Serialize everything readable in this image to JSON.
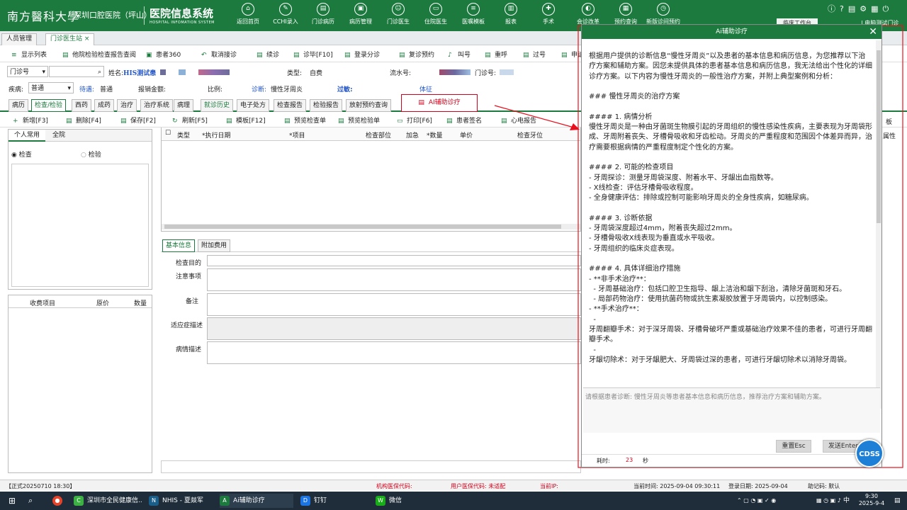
{
  "header": {
    "logo_brand": "南方醫科大學",
    "hospital": "深圳口腔医院（坪山）",
    "system_title": "医院信息系统",
    "system_subtitle": "HOSPITAL INFOMATION SYSTEM",
    "nav": [
      {
        "label": "返回首页",
        "icon": "home-icon",
        "glyph": "⌂"
      },
      {
        "label": "CCHI录入",
        "icon": "edit-icon",
        "glyph": "✎"
      },
      {
        "label": "门诊病历",
        "icon": "record-icon",
        "glyph": "▤"
      },
      {
        "label": "病历管理",
        "icon": "folder-icon",
        "glyph": "▣"
      },
      {
        "label": "门诊医生",
        "icon": "doctor-icon",
        "glyph": "☺"
      },
      {
        "label": "住院医生",
        "icon": "bed-icon",
        "glyph": "▭"
      },
      {
        "label": "医嘱模板",
        "icon": "template-icon",
        "glyph": "≡"
      },
      {
        "label": "报表",
        "icon": "chart-icon",
        "glyph": "▥"
      },
      {
        "label": "手术",
        "icon": "surgery-icon",
        "glyph": "✚"
      },
      {
        "label": "会诊改革",
        "icon": "consult-icon",
        "glyph": "◐"
      },
      {
        "label": "预约查询",
        "icon": "calendar-icon",
        "glyph": "▦"
      },
      {
        "label": "新版诊间预约",
        "icon": "clock-icon",
        "glyph": "◷"
      }
    ],
    "workspace": "临床工作台",
    "user": "| 电脑测试门诊"
  },
  "tabs": [
    "人员管理",
    "门诊医生站"
  ],
  "toolbar": [
    {
      "label": "显示列表",
      "icon": "list-icon",
      "g": "≡"
    },
    {
      "label": "他院检验检查报告查阅",
      "icon": "report-icon",
      "g": "▤"
    },
    {
      "label": "患者360",
      "icon": "patient-icon",
      "g": "▣"
    },
    {
      "label": "取消接诊",
      "icon": "cancel-icon",
      "g": "↶"
    },
    {
      "label": "续诊",
      "icon": "continue-icon",
      "g": "▤"
    },
    {
      "label": "诊毕[F10]",
      "icon": "finish-icon",
      "g": "▤"
    },
    {
      "label": "登录分诊",
      "icon": "login-icon",
      "g": "▤"
    },
    {
      "label": "复诊预约",
      "icon": "revisit-icon",
      "g": "▤"
    },
    {
      "label": "叫号",
      "icon": "bell-icon",
      "g": "♪"
    },
    {
      "label": "重呼",
      "icon": "recall-icon",
      "g": "▤"
    },
    {
      "label": "过号",
      "icon": "skip-icon",
      "g": "▤"
    },
    {
      "label": "申请",
      "icon": "apply-icon",
      "g": "▤"
    }
  ],
  "patient": {
    "clinic_label": "门诊号",
    "name_label": "姓名:",
    "name": "HIS测试患",
    "type_label": "类型:",
    "type": "自费",
    "serial_label": "流水号:",
    "clinic_no_label": "门诊号:",
    "disease_label": "疾病:",
    "disease": "普通",
    "benefit_label": "待遇:",
    "benefit": "普通",
    "amount_label": "报销金额:",
    "ratio_label": "比例:",
    "diagnosis_label": "诊断:",
    "diagnosis": "慢性牙周炎",
    "allergy_label": "过敏:",
    "sign_label": "体征"
  },
  "subtabs": [
    "病历",
    "检查/检验",
    "西药",
    "成药",
    "治疗",
    "治疗系统",
    "病理",
    "就诊历史",
    "电子处方",
    "检查报告",
    "检验报告",
    "放射预约查询"
  ],
  "ai_tab": "AI辅助诊疗",
  "toolbar2": [
    {
      "label": "新增[F3]",
      "icon": "add-icon",
      "g": "+"
    },
    {
      "label": "删除[F4]",
      "icon": "delete-icon",
      "g": "▤"
    },
    {
      "label": "保存[F2]",
      "icon": "save-icon",
      "g": "▤"
    },
    {
      "label": "刷新[F5]",
      "icon": "refresh-icon",
      "g": "↻"
    },
    {
      "label": "模板[F12]",
      "icon": "template-icon",
      "g": "▤"
    },
    {
      "label": "预览检查单",
      "icon": "preview-icon",
      "g": "▤"
    },
    {
      "label": "预览检验单",
      "icon": "preview-icon",
      "g": "▤"
    },
    {
      "label": "打印[F6]",
      "icon": "print-icon",
      "g": "▭"
    },
    {
      "label": "患者签名",
      "icon": "sign-icon",
      "g": "▤"
    },
    {
      "label": "心电报告",
      "icon": "ecg-icon",
      "g": "▤"
    }
  ],
  "left_tabs": [
    "个人常用",
    "全院"
  ],
  "left_radios": [
    "检查",
    "检验"
  ],
  "fee_cols": [
    "收费项目",
    "原价",
    "数量"
  ],
  "grid_cols": [
    "类型",
    "*执行日期",
    "*项目",
    "检查部位",
    "加急",
    "*数量",
    "单价",
    "检查牙位"
  ],
  "right_peek": [
    "板",
    "属性"
  ],
  "form_tabs": [
    "基本信息",
    "附加费用"
  ],
  "form_labels": [
    "检查目的",
    "注意事项",
    "备注",
    "适应症描述",
    "病情描述"
  ],
  "dialog": {
    "title": "Ai辅助诊疗",
    "close": "✕",
    "paragraphs": [
      "根据用户提供的诊断信息“慢性牙周炎”以及患者的基本信息和病历信息，为您推荐以下治疗方案和辅助方案。因您未提供具体的患者基本信息和病历信息，我无法给出个性化的详细诊疗方案。以下内容为慢性牙周炎的一般性治疗方案，并附上典型案例和分析：",
      "",
      "### 慢性牙周炎的治疗方案",
      "",
      "#### 1. 病情分析",
      "慢性牙周炎是一种由牙菌斑生物膜引起的牙周组织的慢性感染性疾病，主要表现为牙周袋形成、牙周附着丧失、牙槽骨吸收和牙齿松动。牙周炎的严重程度和范围因个体差异而异，治疗需要根据病情的严重程度制定个性化的方案。",
      "",
      "#### 2. 可能的检查项目",
      "- 牙周探诊：测量牙周袋深度、附着水平、牙龈出血指数等。",
      "- X线检查：评估牙槽骨吸收程度。",
      "- 全身健康评估：排除或控制可能影响牙周炎的全身性疾病，如糖尿病。",
      "",
      "#### 3. 诊断依据",
      "- 牙周袋深度超过4mm，附着丧失超过2mm。",
      "- 牙槽骨吸收X线表现为垂直或水平吸收。",
      "- 牙周组织的临床炎症表现。",
      "",
      "#### 4. 具体详细治疗措施",
      "- **非手术治疗**：",
      "  - 牙周基础治疗：包括口腔卫生指导、龈上洁治和龈下刮治，清除牙菌斑和牙石。",
      "  - 局部药物治疗：使用抗菌药物或抗生素凝胶放置于牙周袋内，以控制感染。",
      "- **手术治疗**：",
      "  -",
      "牙周翻瓣手术：对于深牙周袋、牙槽骨破坏严重或基础治疗效果不佳的患者，可进行牙周翻瓣手术。",
      "  -",
      "牙龈切除术：对于牙龈肥大、牙周袋过深的患者，可进行牙龈切除术以消除牙周袋。"
    ],
    "prompt": "请根据患者诊断: 慢性牙周炎等患者基本信息和病历信息，推荐治疗方案和辅助方案。",
    "reset": "重置Esc",
    "send": "发送Enter",
    "time_label": "耗时:",
    "time_value": "23",
    "time_unit": "秒"
  },
  "cdss": "CDSS",
  "status": {
    "version": "【正式20250710 18:30】",
    "org_code": "机构医保代码:",
    "user_code": "用户医保代码: 未适配",
    "ip": "当前IP:",
    "current_time": "当前时间: 2025-09-04 09:30:11",
    "login_date": "登录日期: 2025-09-04",
    "helper": "助记码: 默认"
  },
  "taskbar": {
    "apps": [
      {
        "label": "深圳市全民健康信...",
        "icon": "browser-icon",
        "c": "#3cb043",
        "g": "C"
      },
      {
        "label": "NHIS - 夏燚军",
        "icon": "nhis-icon",
        "c": "#1a5e8a",
        "g": "N"
      },
      {
        "label": "Ai辅助诊疗",
        "icon": "ai-app-icon",
        "c": "#1c7a3e",
        "g": "A"
      },
      {
        "label": "钉钉",
        "icon": "dingtalk-icon",
        "c": "#1b74e4",
        "g": "D"
      },
      {
        "label": "微信",
        "icon": "wechat-icon",
        "c": "#19ad19",
        "g": "W"
      }
    ],
    "time": "9:30",
    "date": "2025-9-4",
    "lang": "中"
  }
}
